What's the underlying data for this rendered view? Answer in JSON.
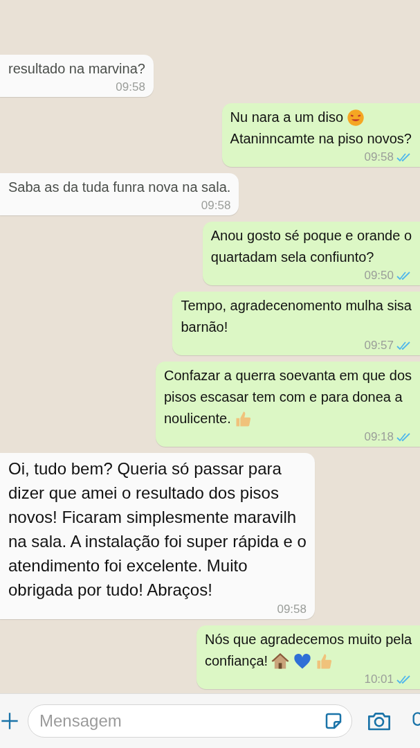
{
  "messages": [
    {
      "kind": "received",
      "lines": [
        {
          "text": "resultado na marvina?"
        }
      ],
      "time": "09:58"
    },
    {
      "kind": "sent",
      "lines": [
        {
          "text": "Nu nara a um diso",
          "emoji": [
            {
              "kind": "face"
            }
          ]
        },
        {
          "text": "Ataninncamte na piso novos?"
        }
      ],
      "time": "09:58",
      "read": true
    },
    {
      "kind": "received",
      "lines": [
        {
          "text": "Saba as da tuda funra nova na sala."
        }
      ],
      "time": "09:58"
    },
    {
      "kind": "sent",
      "lines": [
        {
          "text": "Anou gosto sé poque e orande o"
        },
        {
          "text": "quartadam sela confiunto?"
        }
      ],
      "time": "09:50",
      "read": true
    },
    {
      "kind": "sent",
      "lines": [
        {
          "text": "Tempo, agradecenomento mulha sisa"
        },
        {
          "text": "barnão!"
        }
      ],
      "time": "09:57",
      "read": true
    },
    {
      "kind": "sent",
      "lines": [
        {
          "text": "Confazar a querra soevanta em que dos"
        },
        {
          "text": "pisos escasar tem com e para donea a"
        },
        {
          "text": "noulicente.",
          "emoji": [
            {
              "kind": "thumbs"
            }
          ]
        }
      ],
      "time": "09:18",
      "read": true
    },
    {
      "kind": "received",
      "lines": [
        {
          "text": "Oi, tudo bem? Queria só passar para"
        },
        {
          "text": "dizer que amei o resultado dos pisos"
        },
        {
          "text": "novos! Ficaram simplesmente maravilh"
        },
        {
          "text": "na sala. A instalação foi super rápida e o"
        },
        {
          "text": "atendimento foi excelente. Muito"
        },
        {
          "text": "obrigada por tudo! Abraços!"
        }
      ],
      "time": "09:58"
    },
    {
      "kind": "sent",
      "lines": [
        {
          "text": "Nós que agradecemos muito pela"
        },
        {
          "text": "confiança!",
          "emoji": [
            {
              "kind": "house"
            },
            {
              "kind": "heart"
            },
            {
              "kind": "thumbs"
            }
          ]
        }
      ],
      "time": "10:01",
      "read": true
    }
  ],
  "composer": {
    "placeholder": "Mensagem"
  }
}
